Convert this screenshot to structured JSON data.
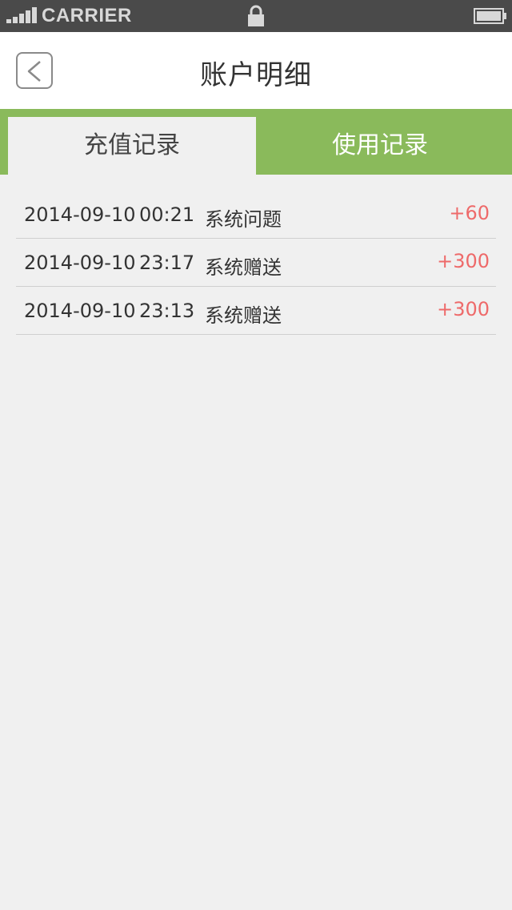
{
  "statusbar": {
    "carrier": "CARRIER",
    "signal_icon": "signal-bars-icon",
    "lock_icon": "lock-icon",
    "battery_icon": "battery-icon"
  },
  "header": {
    "title": "账户明细",
    "back_icon": "chevron-left-icon"
  },
  "tabs": [
    {
      "label": "充值记录",
      "active": true
    },
    {
      "label": "使用记录",
      "active": false
    }
  ],
  "records": [
    {
      "date": "2014-09-10",
      "time": "00:21",
      "desc": "系统问题",
      "amount": "+60"
    },
    {
      "date": "2014-09-10",
      "time": "23:17",
      "desc": "系统赠送",
      "amount": "+300"
    },
    {
      "date": "2014-09-10",
      "time": "23:13",
      "desc": "系统赠送",
      "amount": "+300"
    }
  ],
  "colors": {
    "accent_green": "#8aba5b",
    "amount_red": "#ee6a6a",
    "background": "#f0f0f0"
  }
}
